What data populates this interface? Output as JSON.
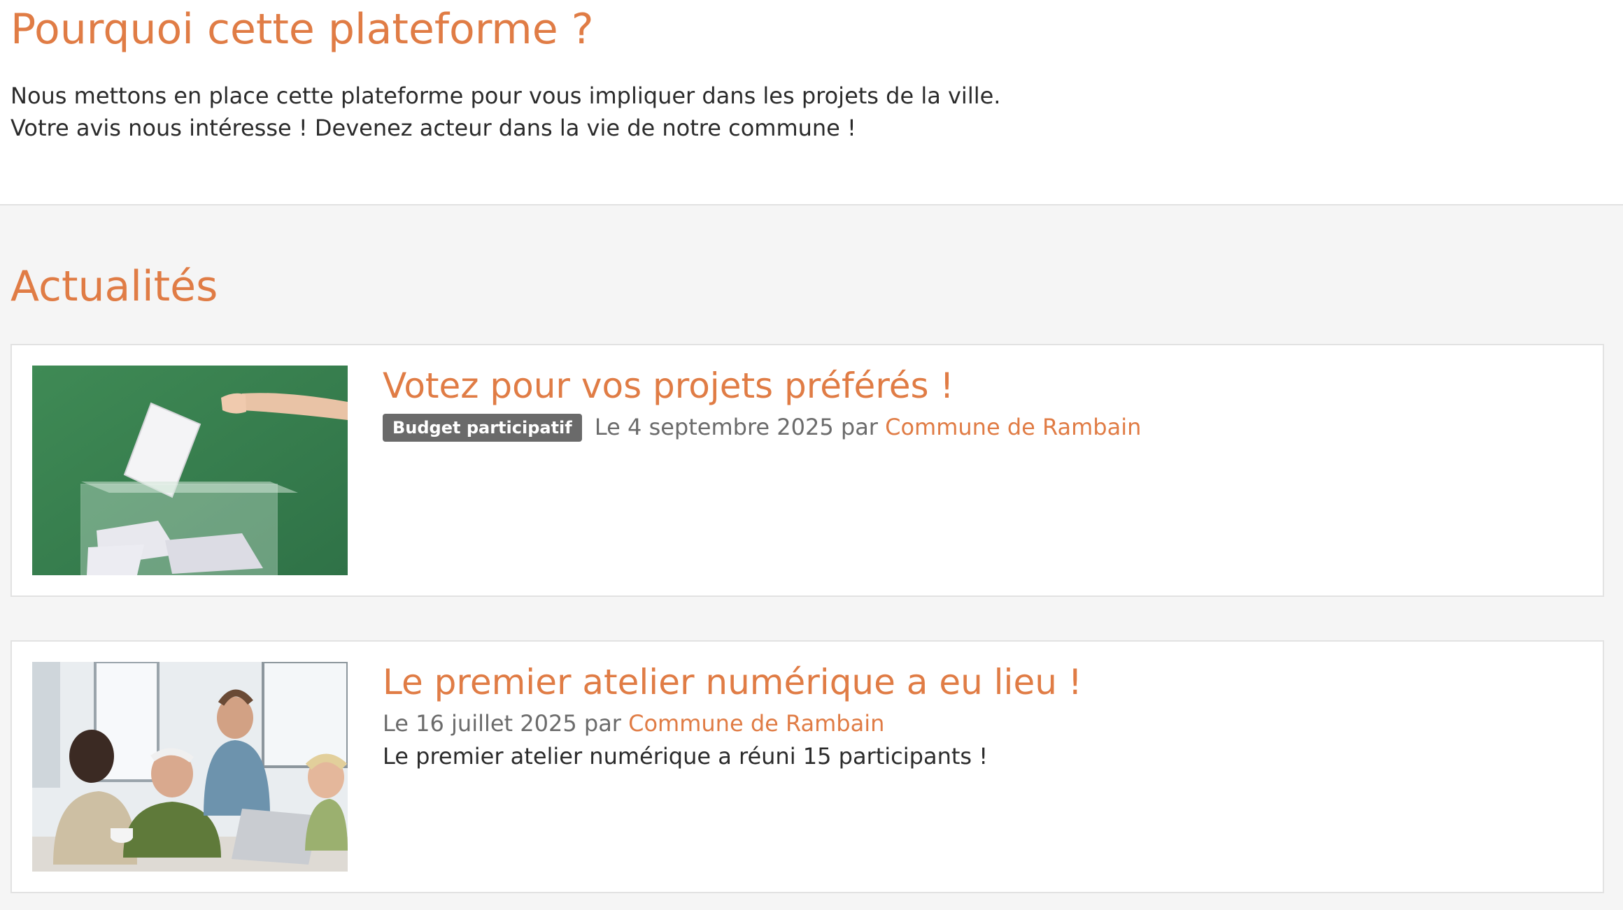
{
  "intro": {
    "title": "Pourquoi cette plateforme ?",
    "line1": "Nous mettons en place cette plateforme pour vous impliquer dans les projets de la ville.",
    "line2": "Votre avis nous intéresse ! Devenez acteur dans la vie de notre commune !"
  },
  "news": {
    "heading": "Actualités",
    "articles": [
      {
        "title": "Votez pour vos projets préférés !",
        "tag": "Budget participatif",
        "date_prefix": "Le 4 septembre 2025 par",
        "author": "Commune de Rambain",
        "excerpt": ""
      },
      {
        "title": "Le premier atelier numérique a eu lieu !",
        "tag": "",
        "date_prefix": "Le 16 juillet 2025 par",
        "author": "Commune de Rambain",
        "excerpt": "Le premier atelier numérique a réuni 15 participants !"
      }
    ]
  },
  "colors": {
    "accent": "#e07c45",
    "tag_bg": "#6a6a6a",
    "page_bg": "#f5f5f5"
  }
}
